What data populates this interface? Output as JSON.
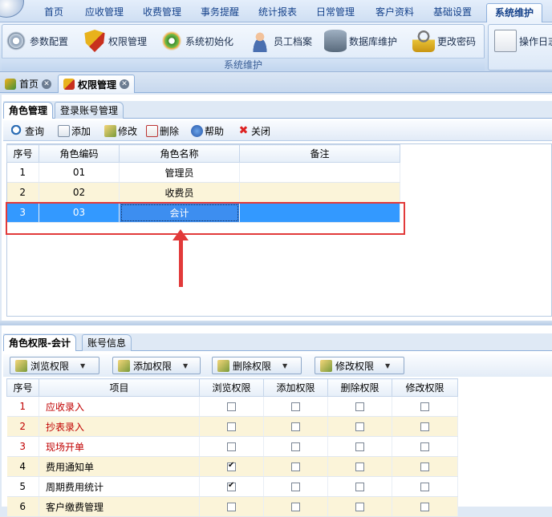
{
  "menu_tabs": [
    "首页",
    "应收管理",
    "收费管理",
    "事务提醒",
    "统计报表",
    "日常管理",
    "客户资料",
    "基础设置",
    "系统维护"
  ],
  "ribbon": {
    "buttons": [
      {
        "label": "参数配置",
        "icon": "gear-icon"
      },
      {
        "label": "权限管理",
        "icon": "shield-icon"
      },
      {
        "label": "系统初始化",
        "icon": "colorful-gear-icon"
      },
      {
        "label": "员工档案",
        "icon": "user-icon"
      },
      {
        "label": "数据库维护",
        "icon": "database-icon"
      },
      {
        "label": "更改密码",
        "icon": "lock-icon"
      },
      {
        "label": "操作日志",
        "icon": "document-icon"
      }
    ],
    "group_label": "系统维护"
  },
  "doc_tabs": [
    {
      "label": "首页",
      "close": "✕"
    },
    {
      "label": "权限管理",
      "close": "✕"
    }
  ],
  "upper": {
    "tabs": [
      "角色管理",
      "登录账号管理"
    ],
    "toolbar": [
      "查询",
      "添加",
      "修改",
      "删除",
      "帮助",
      "关闭"
    ],
    "columns": [
      "序号",
      "角色编码",
      "角色名称",
      "备注"
    ],
    "rows": [
      {
        "no": "1",
        "code": "01",
        "name": "管理员",
        "note": ""
      },
      {
        "no": "2",
        "code": "02",
        "name": "收费员",
        "note": ""
      },
      {
        "no": "3",
        "code": "03",
        "name": "会计",
        "note": ""
      }
    ]
  },
  "lower": {
    "tabs": [
      "角色权限-会计",
      "账号信息"
    ],
    "buttons": [
      "浏览权限",
      "添加权限",
      "删除权限",
      "修改权限"
    ],
    "dropdown_arrow": "▼",
    "columns": [
      "序号",
      "项目",
      "浏览权限",
      "添加权限",
      "删除权限",
      "修改权限"
    ],
    "rows": [
      {
        "no": "1",
        "item": "应收录入",
        "view": false,
        "add": false,
        "del": false,
        "edit": false,
        "red": true
      },
      {
        "no": "2",
        "item": "抄表录入",
        "view": false,
        "add": false,
        "del": false,
        "edit": false,
        "red": true
      },
      {
        "no": "3",
        "item": "现场开单",
        "view": false,
        "add": false,
        "del": false,
        "edit": false,
        "red": true
      },
      {
        "no": "4",
        "item": "费用通知单",
        "view": true,
        "add": false,
        "del": false,
        "edit": false,
        "red": false
      },
      {
        "no": "5",
        "item": "周期费用统计",
        "view": true,
        "add": false,
        "del": false,
        "edit": false,
        "red": false
      },
      {
        "no": "6",
        "item": "客户缴费管理",
        "view": false,
        "add": false,
        "del": false,
        "edit": false,
        "red": false
      }
    ]
  },
  "colors": {
    "selection": "#3399ff",
    "annotation": "#e23a3a",
    "alt_row": "#fbf4d9",
    "red_text": "#c00000"
  }
}
